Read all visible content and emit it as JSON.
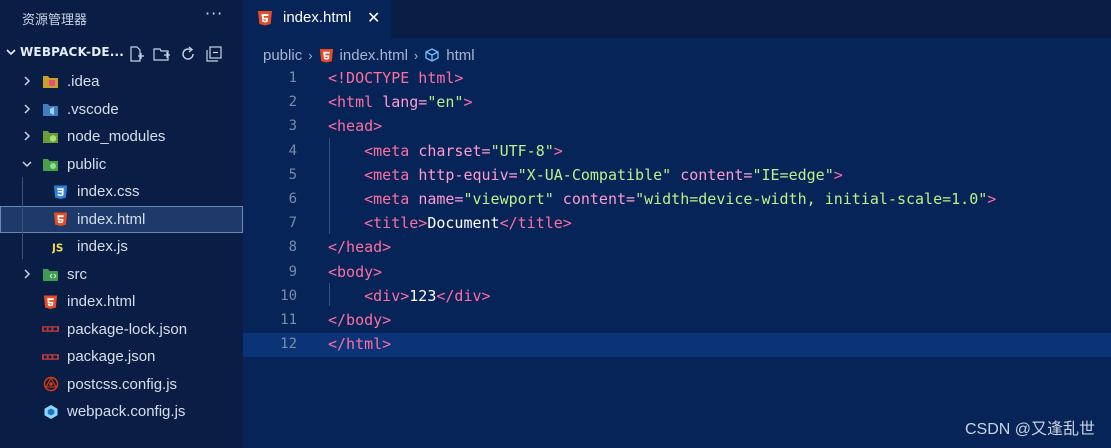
{
  "sidebar": {
    "title": "资源管理器",
    "more": "···",
    "project": "WEBPACK-DE...",
    "items": [
      {
        "label": ".idea",
        "icon": "idea-folder-icon",
        "indent": 0,
        "arrow": "right"
      },
      {
        "label": ".vscode",
        "icon": "vscode-folder-icon",
        "indent": 0,
        "arrow": "right"
      },
      {
        "label": "node_modules",
        "icon": "node-folder-icon",
        "indent": 0,
        "arrow": "right"
      },
      {
        "label": "public",
        "icon": "public-folder-icon",
        "indent": 0,
        "arrow": "down"
      },
      {
        "label": "index.css",
        "icon": "css-file-icon",
        "indent": 1
      },
      {
        "label": "index.html",
        "icon": "html-file-icon",
        "indent": 1,
        "selected": true
      },
      {
        "label": "index.js",
        "icon": "js-file-icon",
        "indent": 1
      },
      {
        "label": "src",
        "icon": "src-folder-icon",
        "indent": 0,
        "arrow": "right"
      },
      {
        "label": "index.html",
        "icon": "html-file-icon",
        "indent": 0
      },
      {
        "label": "package-lock.json",
        "icon": "npm-file-icon",
        "indent": 0
      },
      {
        "label": "package.json",
        "icon": "npm-file-icon",
        "indent": 0
      },
      {
        "label": "postcss.config.js",
        "icon": "postcss-file-icon",
        "indent": 0
      },
      {
        "label": "webpack.config.js",
        "icon": "webpack-file-icon",
        "indent": 0
      }
    ]
  },
  "tab": {
    "label": "index.html",
    "close": "✕"
  },
  "breadcrumb": {
    "folder": "public",
    "file": "index.html",
    "symbol": "html"
  },
  "code": {
    "line_numbers": [
      "1",
      "2",
      "3",
      "4",
      "5",
      "6",
      "7",
      "8",
      "9",
      "10",
      "11",
      "12"
    ],
    "current_line": 12,
    "lines": [
      [
        {
          "t": "tag",
          "v": "<!DOCTYPE html>"
        }
      ],
      [
        {
          "t": "tag",
          "v": "<html "
        },
        {
          "t": "attr",
          "v": "lang="
        },
        {
          "t": "str",
          "v": "\"en\""
        },
        {
          "t": "tag",
          "v": ">"
        }
      ],
      [
        {
          "t": "tag",
          "v": "<head>"
        }
      ],
      [
        {
          "t": "plain",
          "v": "    "
        },
        {
          "t": "tag",
          "v": "<meta "
        },
        {
          "t": "attr",
          "v": "charset="
        },
        {
          "t": "str",
          "v": "\"UTF-8\""
        },
        {
          "t": "tag",
          "v": ">"
        }
      ],
      [
        {
          "t": "plain",
          "v": "    "
        },
        {
          "t": "tag",
          "v": "<meta "
        },
        {
          "t": "attr",
          "v": "http-equiv="
        },
        {
          "t": "str",
          "v": "\"X-UA-Compatible\""
        },
        {
          "t": "attr",
          "v": " content="
        },
        {
          "t": "str",
          "v": "\"IE=edge\""
        },
        {
          "t": "tag",
          "v": ">"
        }
      ],
      [
        {
          "t": "plain",
          "v": "    "
        },
        {
          "t": "tag",
          "v": "<meta "
        },
        {
          "t": "attr",
          "v": "name="
        },
        {
          "t": "str",
          "v": "\"viewport\""
        },
        {
          "t": "attr",
          "v": " content="
        },
        {
          "t": "str",
          "v": "\"width=device-width, initial-scale=1.0\""
        },
        {
          "t": "tag",
          "v": ">"
        }
      ],
      [
        {
          "t": "plain",
          "v": "    "
        },
        {
          "t": "tag",
          "v": "<title>"
        },
        {
          "t": "plain",
          "v": "Document"
        },
        {
          "t": "tag",
          "v": "</title>"
        }
      ],
      [
        {
          "t": "tag",
          "v": "</head>"
        }
      ],
      [
        {
          "t": "tag",
          "v": "<body>"
        }
      ],
      [
        {
          "t": "plain",
          "v": "    "
        },
        {
          "t": "tag",
          "v": "<div>"
        },
        {
          "t": "plain",
          "v": "123"
        },
        {
          "t": "tag",
          "v": "</div>"
        }
      ],
      [
        {
          "t": "tag",
          "v": "</body>"
        }
      ],
      [
        {
          "t": "tag",
          "v": "</html>"
        }
      ]
    ]
  },
  "watermark": "CSDN @又逢乱世",
  "colors": {
    "background": "#062457",
    "sidebar": "#0a1e45",
    "tag": "#ff6ea0",
    "attr": "#ff9bd0",
    "string": "#b7f28a",
    "html_icon": "#e44d26",
    "css_icon": "#2f80d8",
    "js_icon": "#f0db4f"
  }
}
